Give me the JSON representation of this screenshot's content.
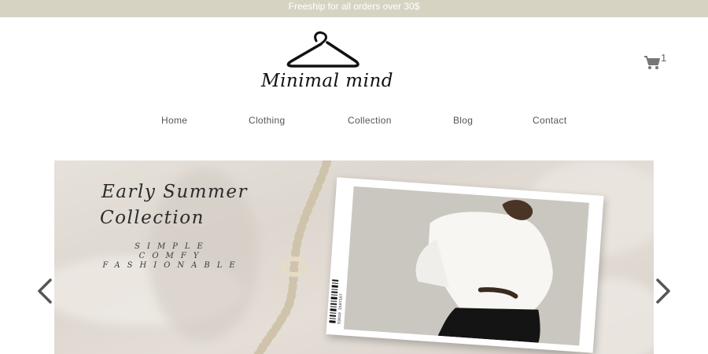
{
  "announcement": {
    "text": "Freeship for all orders over 30$"
  },
  "brand": {
    "name": "Minimal mind",
    "logo_icon": "hanger-icon"
  },
  "cart": {
    "icon": "cart-icon",
    "count": "1"
  },
  "nav": {
    "items": [
      {
        "label": "Home"
      },
      {
        "label": "Clothing"
      },
      {
        "label": "Collection"
      },
      {
        "label": "Blog"
      },
      {
        "label": "Contact"
      }
    ]
  },
  "hero": {
    "title_line1": "Early Summer",
    "title_line2": "Collection",
    "tagline": [
      "SIMPLE",
      "COMFY",
      "FASHIONABLE"
    ],
    "barcode_text": "53610 3107167",
    "prev_icon": "chevron-left-icon",
    "next_icon": "chevron-right-icon"
  },
  "colors": {
    "announcement_bg": "#d7d3c3",
    "text_dark": "#2b2b2b",
    "nav_text": "#555555",
    "arrow": "#555555"
  }
}
